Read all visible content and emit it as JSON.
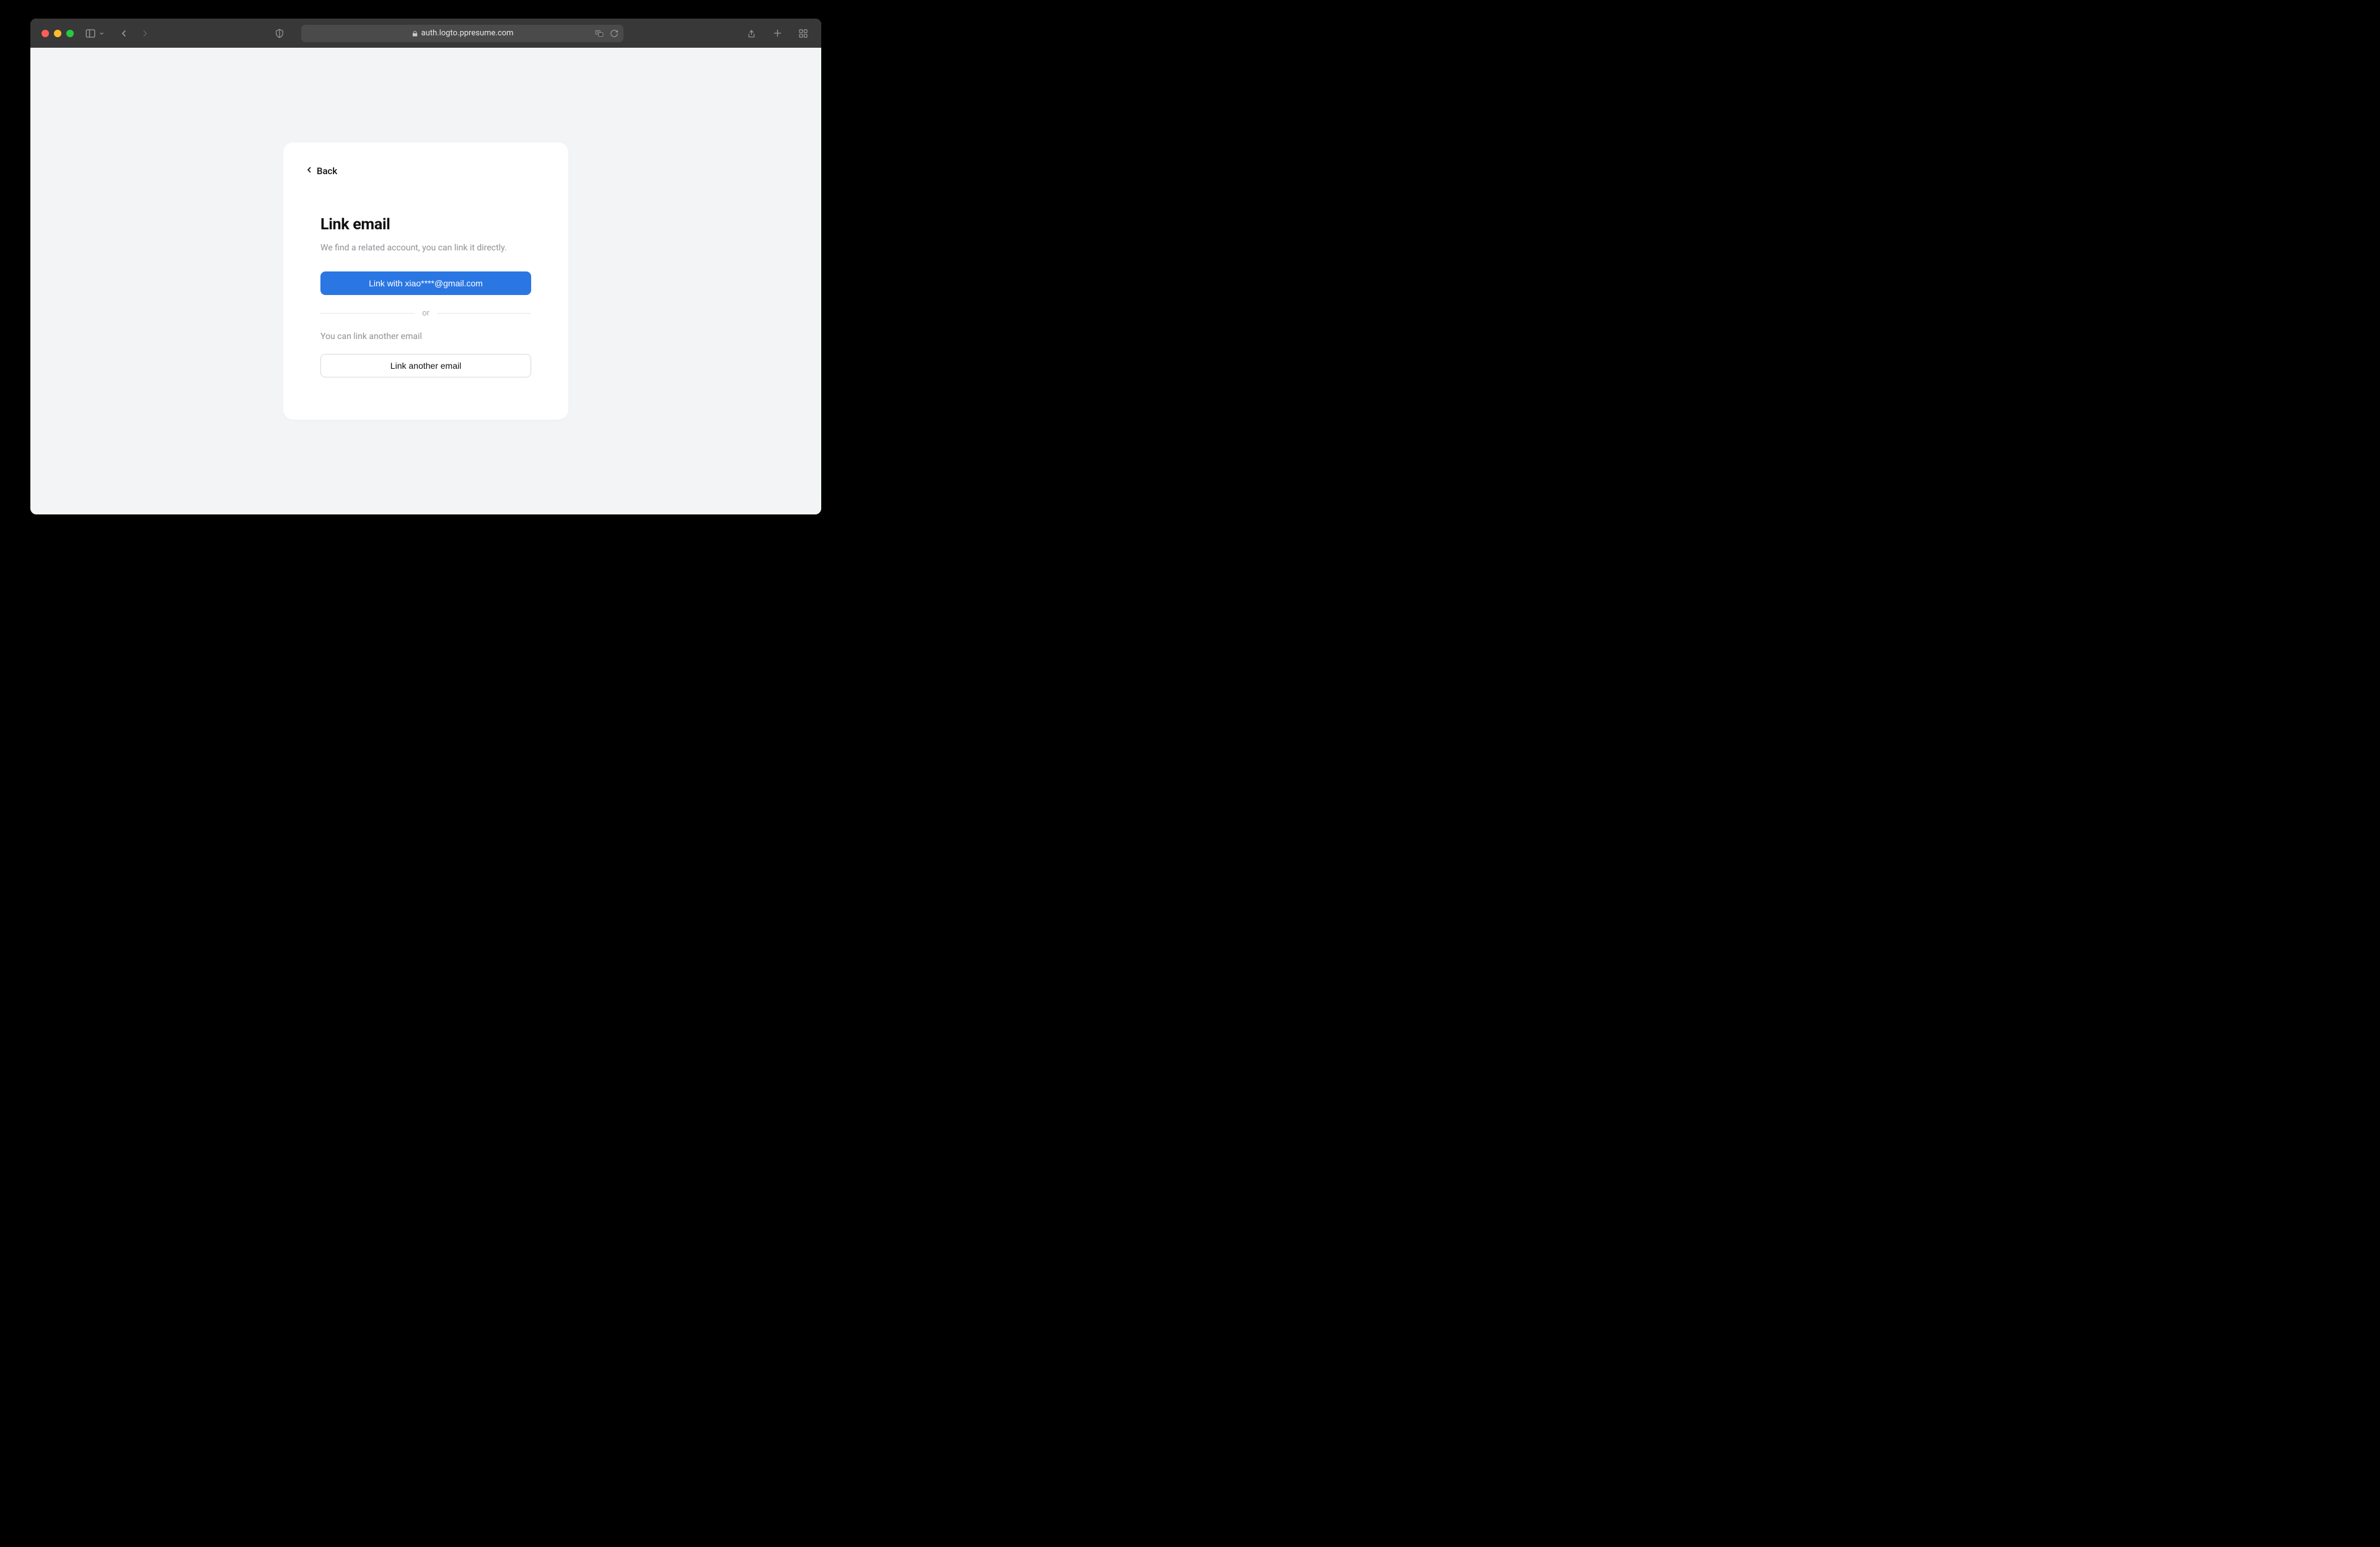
{
  "browser": {
    "url": "auth.logto.ppresume.com"
  },
  "card": {
    "back_label": "Back",
    "title": "Link email",
    "subtitle": "We find a related account, you can link it directly.",
    "primary_button": "Link with xiao****@gmail.com",
    "divider": "or",
    "secondary_sub": "You can link another email",
    "secondary_button": "Link another email"
  }
}
